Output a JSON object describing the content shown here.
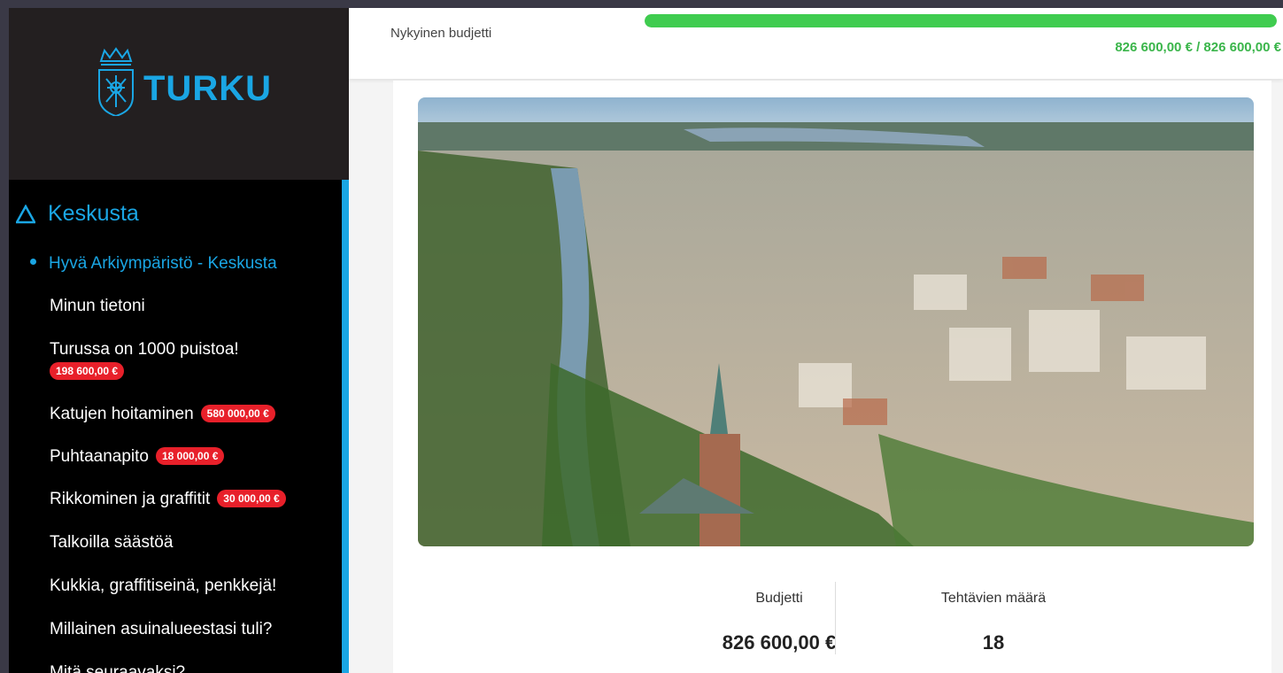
{
  "brand": {
    "name": "TURKU",
    "accent": "#1aa6e4"
  },
  "sidebar": {
    "section_title": "Keskusta",
    "items": [
      {
        "label": "Hyvä Arkiympäristö - Keskusta",
        "active": true
      },
      {
        "label": "Minun tietoni"
      },
      {
        "label": "Turussa on 1000 puistoa!",
        "badge": "198 600,00 €"
      },
      {
        "label": "Katujen hoitaminen",
        "badge": "580 000,00 €"
      },
      {
        "label": "Puhtaanapito",
        "badge": "18 000,00 €"
      },
      {
        "label": "Rikkominen ja graffitit",
        "badge": "30 000,00 €"
      },
      {
        "label": "Talkoilla säästöä"
      },
      {
        "label": "Kukkia, graffitiseinä, penkkejä!"
      },
      {
        "label": "Millainen asuinalueestasi tuli?"
      },
      {
        "label": "Mitä seuraavaksi?"
      }
    ]
  },
  "header": {
    "budget_label": "Nykyinen budjetti",
    "progress_fraction": 1.0,
    "progress_text": "826 600,00 € / 826 600,00 €",
    "progress_color": "#3fcc4f"
  },
  "stats": {
    "budget_label": "Budjetti",
    "budget_value": "826 600,00 €",
    "tasks_label": "Tehtävien määrä",
    "tasks_value": "18"
  }
}
